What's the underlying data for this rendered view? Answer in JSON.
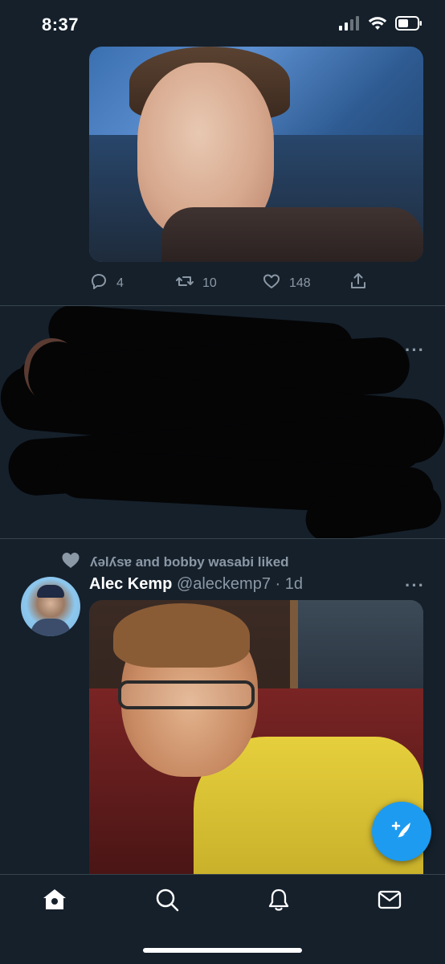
{
  "status_bar": {
    "time": "8:37"
  },
  "tweets": [
    {
      "stats": {
        "replies": "4",
        "retweets": "10",
        "likes": "148"
      }
    },
    {
      "redacted": true
    },
    {
      "social_context": "ʎəlʎsɐ and bobby wasabi liked",
      "display_name": "Alec Kemp",
      "handle": "@aleckemp7",
      "time": "· 1d"
    }
  ],
  "icons": {
    "tab_home": "home-icon",
    "tab_search": "search-icon",
    "tab_notifications": "bell-icon",
    "tab_messages": "mail-icon",
    "fab": "compose-tweet-icon"
  },
  "colors": {
    "background": "#15202b",
    "accent": "#1d9bf0",
    "secondary_text": "#8b98a5",
    "divider": "#38444d"
  }
}
